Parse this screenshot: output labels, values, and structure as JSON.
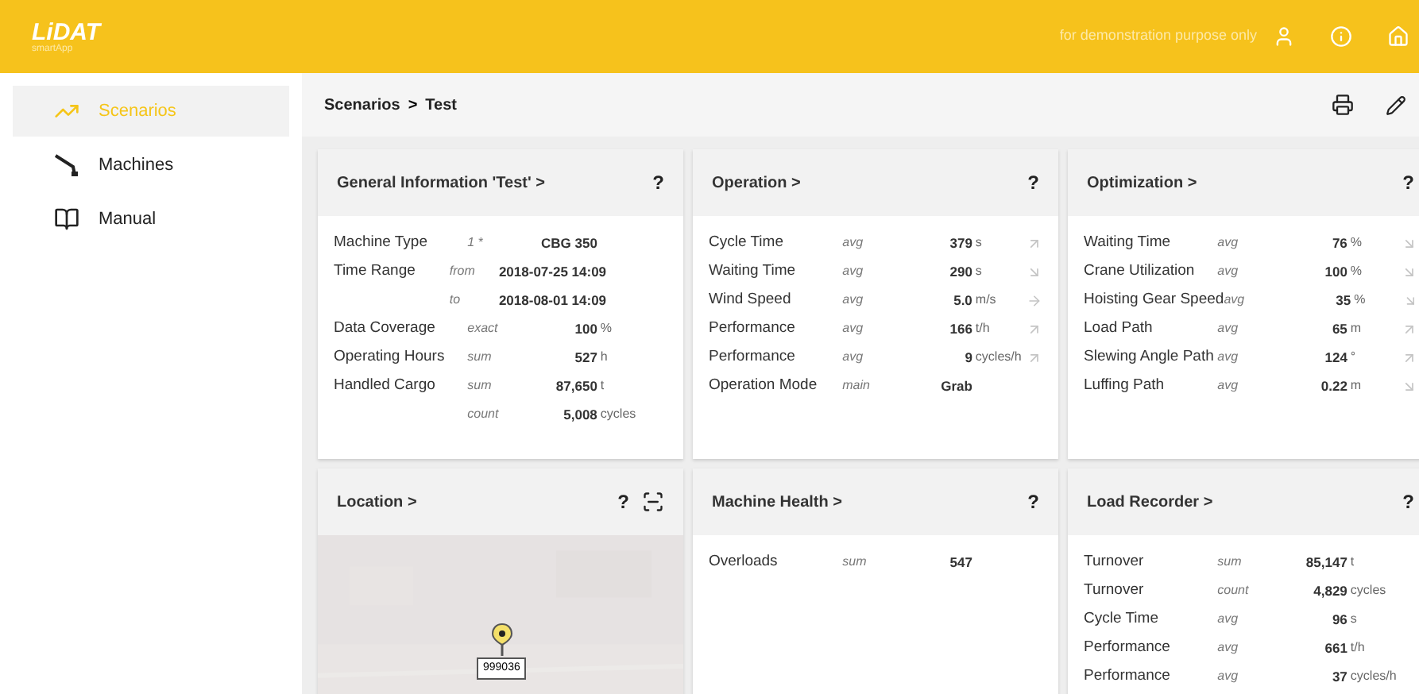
{
  "header": {
    "logo": "LiDAT",
    "logo_sub": "smartApp",
    "notice": "for demonstration purpose only"
  },
  "sidebar": {
    "items": [
      {
        "label": "Scenarios",
        "selected": true
      },
      {
        "label": "Machines",
        "selected": false
      },
      {
        "label": "Manual",
        "selected": false
      }
    ]
  },
  "breadcrumb": {
    "items": [
      "Scenarios",
      "Test"
    ],
    "separator": ">"
  },
  "cards": [
    {
      "kind": "stats",
      "title": "General Information 'Test'",
      "chevron": ">",
      "help": "?",
      "rows": [
        {
          "label": "Machine Type",
          "qualifier": "1 *",
          "value": "CBG 350"
        },
        {
          "label": "Time Range",
          "qualifier": "from",
          "value": "2018-07-25 14:09"
        },
        {
          "qualifier": "to",
          "value": "2018-08-01 14:09"
        },
        {
          "label": "Data Coverage",
          "qualifier": "exact",
          "value": "100",
          "unit": "%"
        },
        {
          "label": "Operating Hours",
          "qualifier": "sum",
          "value": "527",
          "unit": "h"
        },
        {
          "label": "Handled Cargo",
          "qualifier": "sum",
          "value": "87,650",
          "unit": "t"
        },
        {
          "qualifier": "count",
          "value": "5,008",
          "unit": "cycles"
        }
      ]
    },
    {
      "kind": "stats",
      "title": "Operation",
      "chevron": ">",
      "help": "?",
      "rows": [
        {
          "label": "Cycle Time",
          "qualifier": "avg",
          "value": "379",
          "unit": "s",
          "kind": "rising"
        },
        {
          "label": "Waiting Time",
          "qualifier": "avg",
          "value": "290",
          "unit": "s",
          "kind": "falling"
        },
        {
          "label": "Wind Speed",
          "qualifier": "avg",
          "value": "5.0",
          "unit": "m/s",
          "kind": "steady"
        },
        {
          "label": "Performance",
          "qualifier": "avg",
          "value": "166",
          "unit": "t/h",
          "kind": "rising"
        },
        {
          "label": "Performance",
          "qualifier": "avg",
          "value": "9",
          "unit": "cycles/h",
          "kind": "rising"
        },
        {
          "label": "Operation Mode",
          "qualifier": "main",
          "value": "Grab"
        }
      ]
    },
    {
      "kind": "stats",
      "title": "Optimization",
      "chevron": ">",
      "help": "?",
      "rows": [
        {
          "label": "Waiting Time",
          "qualifier": "avg",
          "value": "76",
          "unit": "%",
          "kind": "falling"
        },
        {
          "label": "Crane Utilization",
          "qualifier": "avg",
          "value": "100",
          "unit": "%",
          "kind": "falling"
        },
        {
          "label": "Hoisting Gear Speed",
          "qualifier": "avg",
          "value": "35",
          "unit": "%",
          "kind": "falling"
        },
        {
          "label": "Load Path",
          "qualifier": "avg",
          "value": "65",
          "unit": "m",
          "kind": "rising"
        },
        {
          "label": "Slewing Angle Path",
          "qualifier": "avg",
          "value": "124",
          "unit": "°",
          "kind": "rising"
        },
        {
          "label": "Luffing Path",
          "qualifier": "avg",
          "value": "0.22",
          "unit": "m",
          "kind": "falling"
        }
      ]
    },
    {
      "kind": "map",
      "title": "Location",
      "chevron": ">",
      "help": "?",
      "marker": "999036"
    },
    {
      "kind": "stats",
      "title": "Machine Health",
      "chevron": ">",
      "help": "?",
      "rows": [
        {
          "label": "Overloads",
          "qualifier": "sum",
          "value": "547"
        }
      ]
    },
    {
      "kind": "stats",
      "title": "Load Recorder",
      "chevron": ">",
      "help": "?",
      "rows": [
        {
          "label": "Turnover",
          "qualifier": "sum",
          "value": "85,147",
          "unit": "t"
        },
        {
          "label": "Turnover",
          "qualifier": "count",
          "value": "4,829",
          "unit": "cycles"
        },
        {
          "label": "Cycle Time",
          "qualifier": "avg",
          "value": "96",
          "unit": "s"
        },
        {
          "label": "Performance",
          "qualifier": "avg",
          "value": "661",
          "unit": "t/h"
        },
        {
          "label": "Performance",
          "qualifier": "avg",
          "value": "37",
          "unit": "cycles/h"
        }
      ]
    }
  ]
}
